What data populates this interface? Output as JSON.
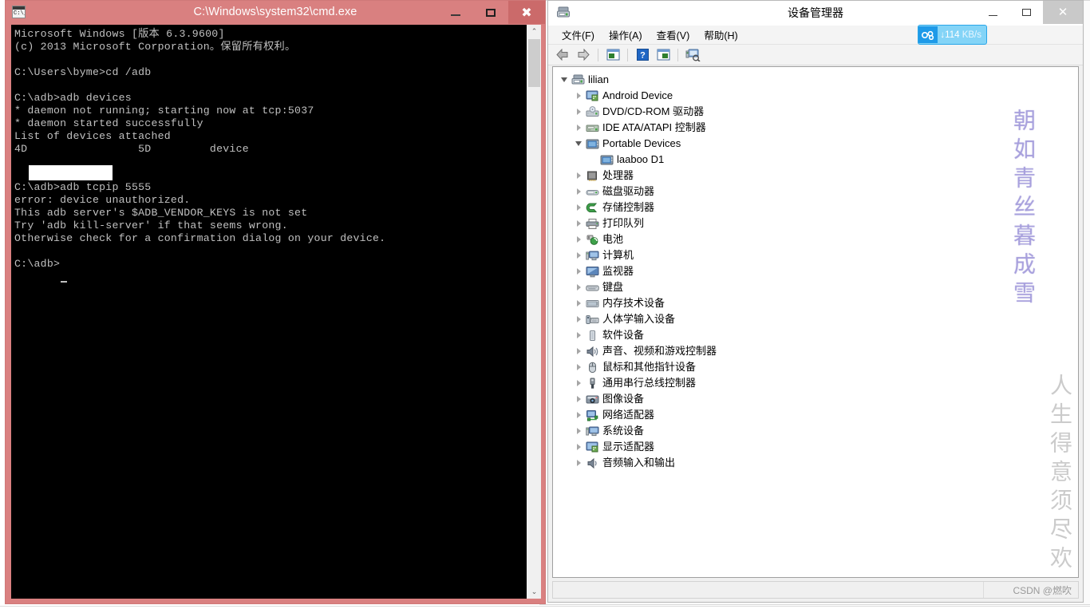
{
  "cmd_window": {
    "title": "C:\\Windows\\system32\\cmd.exe",
    "icon_name": "cmd-icon",
    "minimize_label": "Minimize",
    "maximize_label": "Maximize",
    "close_label": "Close",
    "console_text": "Microsoft Windows [版本 6.3.9600]\n(c) 2013 Microsoft Corporation。保留所有权利。\n\nC:\\Users\\byme>cd /adb\n\nC:\\adb>adb devices\n* daemon not running; starting now at tcp:5037\n* daemon started successfully\nList of devices attached\n4D                 5D         device\n\n\nC:\\adb>adb tcpip 5555\nerror: device unauthorized.\nThis adb server's $ADB_VENDOR_KEYS is not set\nTry 'adb kill-server' if that seems wrong.\nOtherwise check for a confirmation dialog on your device.\n\nC:\\adb>",
    "scrollbar": {
      "up_arrow": "⌃",
      "down_arrow": "⌄"
    }
  },
  "device_manager": {
    "title": "设备管理器",
    "icon_name": "device-manager-icon",
    "minimize_label": "最小化",
    "maximize_label": "最大化",
    "close_label": "关闭",
    "menus": [
      {
        "label": "文件(F)",
        "name": "menu-file"
      },
      {
        "label": "操作(A)",
        "name": "menu-action"
      },
      {
        "label": "查看(V)",
        "name": "menu-view"
      },
      {
        "label": "帮助(H)",
        "name": "menu-help"
      }
    ],
    "toolbar": [
      {
        "name": "back-button",
        "icon": "arrow-left-icon"
      },
      {
        "name": "forward-button",
        "icon": "arrow-right-icon"
      },
      {
        "name": "separator-1",
        "icon": "separator"
      },
      {
        "name": "properties-button",
        "icon": "properties-icon"
      },
      {
        "name": "separator-2",
        "icon": "separator"
      },
      {
        "name": "help-button",
        "icon": "question-mark-icon"
      },
      {
        "name": "show-hide-console-tree-button",
        "icon": "console-tree-icon"
      },
      {
        "name": "separator-3",
        "icon": "separator"
      },
      {
        "name": "scan-hardware-changes-button",
        "icon": "scan-hardware-icon"
      }
    ],
    "speed_badge": {
      "icon_name": "baidu-cloud-icon",
      "arrow": "↓",
      "value": "114",
      "unit": "KB/s"
    },
    "tree": [
      {
        "label": "lilian",
        "depth": 0,
        "state": "expanded",
        "icon": "computer-icon"
      },
      {
        "label": "Android Device",
        "depth": 1,
        "state": "collapsed",
        "icon": "display-adapter-icon"
      },
      {
        "label": "DVD/CD-ROM 驱动器",
        "depth": 1,
        "state": "collapsed",
        "icon": "dvd-drive-icon"
      },
      {
        "label": "IDE ATA/ATAPI 控制器",
        "depth": 1,
        "state": "collapsed",
        "icon": "ide-controller-icon"
      },
      {
        "label": "Portable Devices",
        "depth": 1,
        "state": "expanded",
        "icon": "portable-device-icon"
      },
      {
        "label": "laaboo D1",
        "depth": 2,
        "state": "leaf",
        "icon": "portable-device-icon"
      },
      {
        "label": "处理器",
        "depth": 1,
        "state": "collapsed",
        "icon": "processor-icon"
      },
      {
        "label": "磁盘驱动器",
        "depth": 1,
        "state": "collapsed",
        "icon": "disk-drive-icon"
      },
      {
        "label": "存储控制器",
        "depth": 1,
        "state": "collapsed",
        "icon": "storage-controller-icon"
      },
      {
        "label": "打印队列",
        "depth": 1,
        "state": "collapsed",
        "icon": "printer-icon"
      },
      {
        "label": "电池",
        "depth": 1,
        "state": "collapsed",
        "icon": "battery-icon"
      },
      {
        "label": "计算机",
        "depth": 1,
        "state": "collapsed",
        "icon": "computer-small-icon"
      },
      {
        "label": "监视器",
        "depth": 1,
        "state": "collapsed",
        "icon": "monitor-icon"
      },
      {
        "label": "键盘",
        "depth": 1,
        "state": "collapsed",
        "icon": "keyboard-icon"
      },
      {
        "label": "内存技术设备",
        "depth": 1,
        "state": "collapsed",
        "icon": "memory-device-icon"
      },
      {
        "label": "人体学输入设备",
        "depth": 1,
        "state": "collapsed",
        "icon": "hid-icon"
      },
      {
        "label": "软件设备",
        "depth": 1,
        "state": "collapsed",
        "icon": "software-device-icon"
      },
      {
        "label": "声音、视频和游戏控制器",
        "depth": 1,
        "state": "collapsed",
        "icon": "sound-icon"
      },
      {
        "label": "鼠标和其他指针设备",
        "depth": 1,
        "state": "collapsed",
        "icon": "mouse-icon"
      },
      {
        "label": "通用串行总线控制器",
        "depth": 1,
        "state": "collapsed",
        "icon": "usb-icon"
      },
      {
        "label": "图像设备",
        "depth": 1,
        "state": "collapsed",
        "icon": "imaging-device-icon"
      },
      {
        "label": "网络适配器",
        "depth": 1,
        "state": "collapsed",
        "icon": "network-adapter-icon"
      },
      {
        "label": "系统设备",
        "depth": 1,
        "state": "collapsed",
        "icon": "system-device-icon"
      },
      {
        "label": "显示适配器",
        "depth": 1,
        "state": "collapsed",
        "icon": "display-adapter-icon"
      },
      {
        "label": "音频输入和输出",
        "depth": 1,
        "state": "collapsed",
        "icon": "audio-io-icon"
      }
    ],
    "status_bar": {
      "credit": "CSDN @燃吹"
    }
  },
  "watermarks": {
    "first": "朝如青丝暮成雪",
    "second": "人生得意须尽欢"
  },
  "colors": {
    "cmd_frame": "#d98080",
    "cmd_close": "#cb6a6a",
    "console_bg": "#000000",
    "console_fg": "#c0c0c0",
    "badge_blue": "#1e9ae8",
    "badge_light": "#84d4f7",
    "watermark_purple": "#968cd7",
    "watermark_gray": "#afafaf"
  }
}
